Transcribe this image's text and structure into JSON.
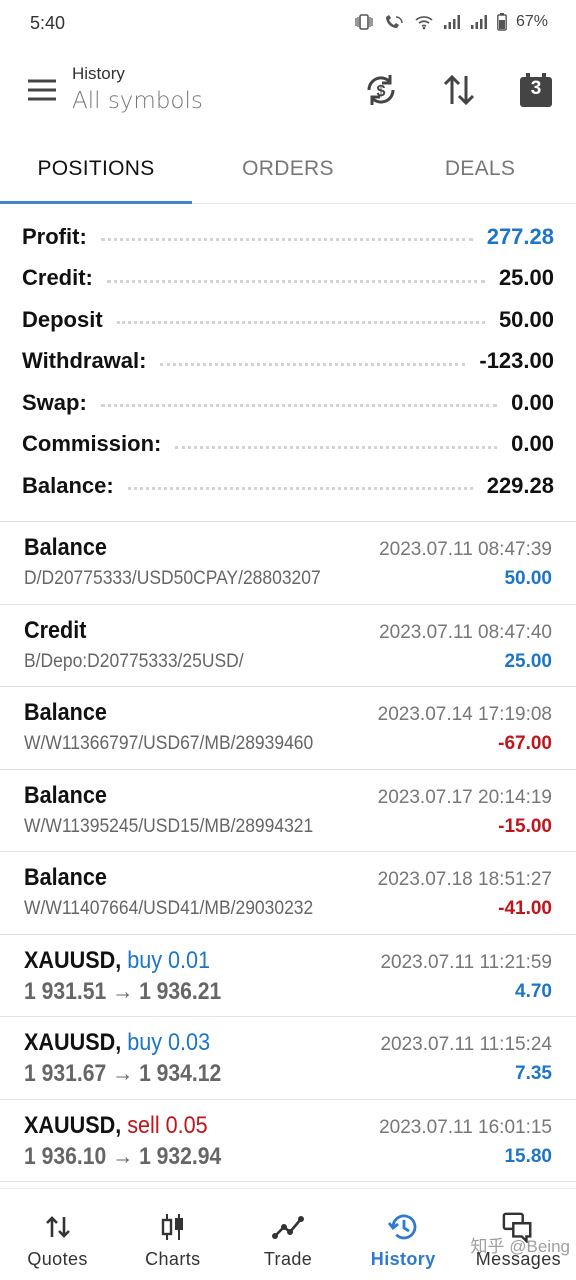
{
  "status_bar": {
    "time": "5:40",
    "battery": "67%"
  },
  "toolbar": {
    "title": "History",
    "subtitle": "All symbols",
    "calendar_number": "3"
  },
  "tabs": [
    {
      "label": "POSITIONS"
    },
    {
      "label": "ORDERS"
    },
    {
      "label": "DEALS"
    }
  ],
  "summary": [
    {
      "label": "Profit:",
      "value": "277.28"
    },
    {
      "label": "Credit:",
      "value": "25.00"
    },
    {
      "label": "Deposit",
      "value": "50.00"
    },
    {
      "label": "Withdrawal:",
      "value": "-123.00"
    },
    {
      "label": "Swap:",
      "value": "0.00"
    },
    {
      "label": "Commission:",
      "value": "0.00"
    },
    {
      "label": "Balance:",
      "value": "229.28"
    }
  ],
  "records": [
    {
      "title": "Balance",
      "detail": "D/D20775333/USD50CPAY/28803207",
      "time": "2023.07.11 08:47:39",
      "amount": "50.00"
    },
    {
      "title": "Credit",
      "detail": "B/Depo:D20775333/25USD/",
      "time": "2023.07.11 08:47:40",
      "amount": "25.00"
    },
    {
      "title": "Balance",
      "detail": "W/W11366797/USD67/MB/28939460",
      "time": "2023.07.14 17:19:08",
      "amount": "-67.00"
    },
    {
      "title": "Balance",
      "detail": "W/W11395245/USD15/MB/28994321",
      "time": "2023.07.17 20:14:19",
      "amount": "-15.00"
    },
    {
      "title": "Balance",
      "detail": "W/W11407664/USD41/MB/29030232",
      "time": "2023.07.18 18:51:27",
      "amount": "-41.00"
    }
  ],
  "trades": [
    {
      "symbol": "XAUUSD,",
      "action": "buy 0.01",
      "prices": "1 931.51 → 1 936.21",
      "time": "2023.07.11 11:21:59",
      "amount": "4.70"
    },
    {
      "symbol": "XAUUSD,",
      "action": "buy 0.03",
      "prices": "1 931.67 → 1 934.12",
      "time": "2023.07.11 11:15:24",
      "amount": "7.35"
    },
    {
      "symbol": "XAUUSD,",
      "action": "sell 0.05",
      "prices": "1 936.10 → 1 932.94",
      "time": "2023.07.11 16:01:15",
      "amount": "15.80"
    }
  ],
  "bottom_nav": [
    {
      "label": "Quotes",
      "icon": "quotes-icon"
    },
    {
      "label": "Charts",
      "icon": "charts-icon"
    },
    {
      "label": "Trade",
      "icon": "trade-icon"
    },
    {
      "label": "History",
      "icon": "history-icon"
    },
    {
      "label": "Messages",
      "icon": "messages-icon"
    }
  ],
  "watermark": "知乎 @Being",
  "colors": {
    "accent": "#1c75c8",
    "negative": "#c0151c",
    "tab_indicator": "#3f88c5",
    "nav_active": "#2d7ad0"
  }
}
